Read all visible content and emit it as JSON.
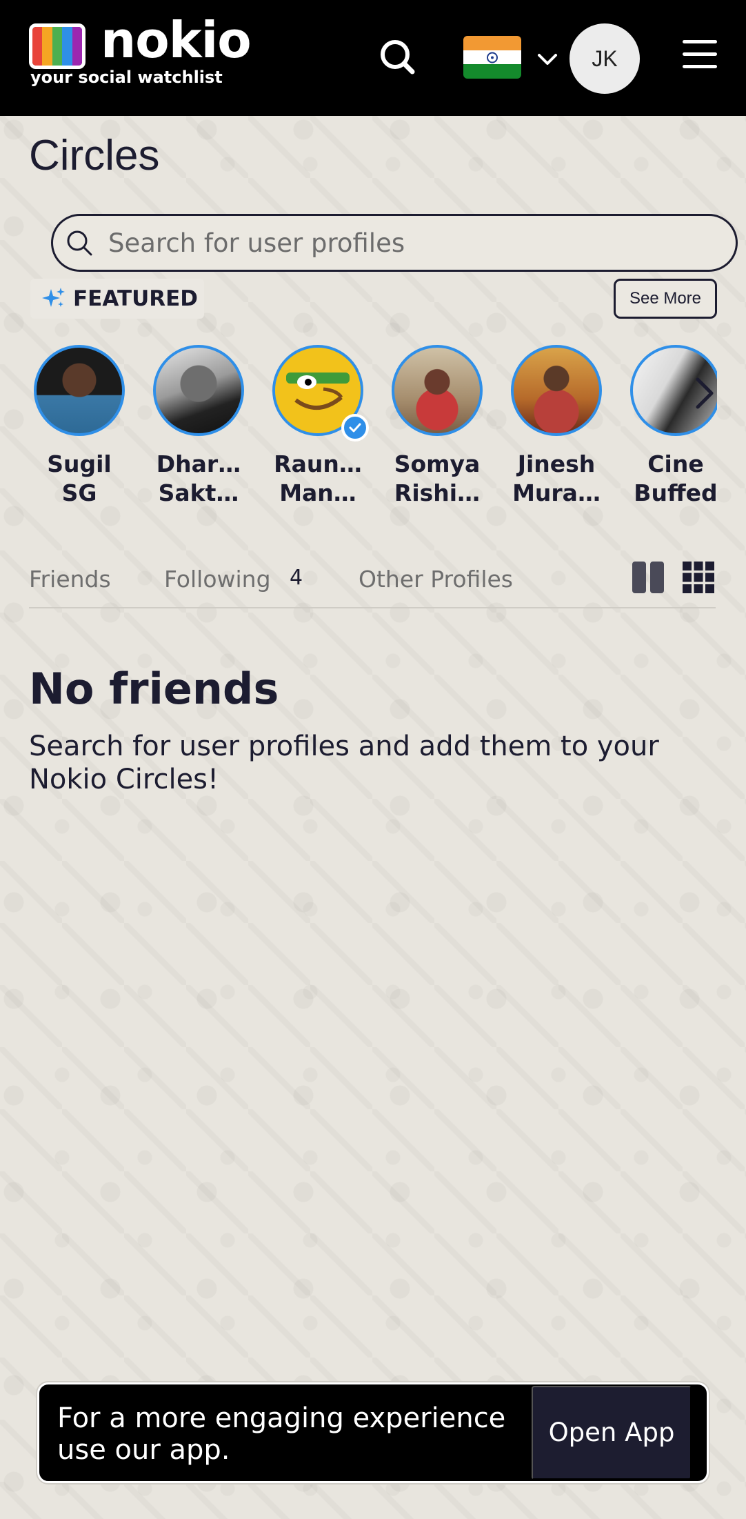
{
  "header": {
    "logo_word": "nokio",
    "logo_tagline": "your social watchlist",
    "avatar_initials": "JK",
    "country_flag": "india-flag-icon"
  },
  "page": {
    "title": "Circles"
  },
  "search": {
    "placeholder": "Search for user profiles"
  },
  "featured": {
    "label": "FEATURED",
    "see_more": "See More",
    "profiles": [
      {
        "line1": "Sugil",
        "line2": "SG",
        "verified": false
      },
      {
        "line1": "Dhar…",
        "line2": "Sakt…",
        "verified": false
      },
      {
        "line1": "Raun…",
        "line2": "Man…",
        "verified": true
      },
      {
        "line1": "Somya",
        "line2": "Rishi…",
        "verified": false
      },
      {
        "line1": "Jinesh",
        "line2": "Mura…",
        "verified": false
      },
      {
        "line1": "Cine",
        "line2": "Buffed",
        "verified": false
      }
    ]
  },
  "tabs": {
    "friends": "Friends",
    "following": "Following",
    "following_count": "4",
    "other": "Other Profiles"
  },
  "empty_state": {
    "title": "No friends",
    "text": "Search for user profiles and add them to your Nokio Circles!"
  },
  "banner": {
    "text": "For a more engaging experience use our app.",
    "button": "Open App"
  },
  "colors": {
    "accent_blue": "#2f8fe8",
    "header_bg": "#000000",
    "page_bg": "#e8e5de",
    "text_dark": "#1c1c30"
  }
}
